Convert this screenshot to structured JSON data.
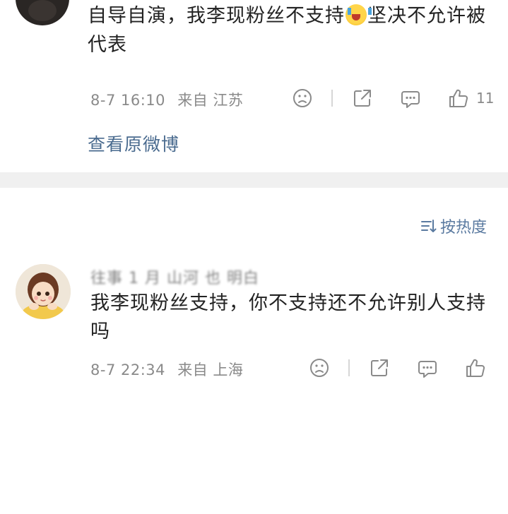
{
  "post": {
    "text_before_emoji": "自导自演，我李现粉丝不支持",
    "emoji": "crying-face-emoji",
    "text_after_emoji": "坚决不允许被代表",
    "date": "8-7 16:10",
    "location": "来自 江苏",
    "like_count": "11",
    "view_original": "查看原微博"
  },
  "sort": {
    "label": "按热度"
  },
  "comment": {
    "username": "往事 1 月 山河 也 明白",
    "text": "我李现粉丝支持，你不支持还不允许别人支持吗",
    "date": "8-7 22:34",
    "location": "来自 上海"
  },
  "colors": {
    "meta_gray": "#8a8a8a",
    "link_blue": "#4a6b8f",
    "separator": "#f0f0f0"
  }
}
